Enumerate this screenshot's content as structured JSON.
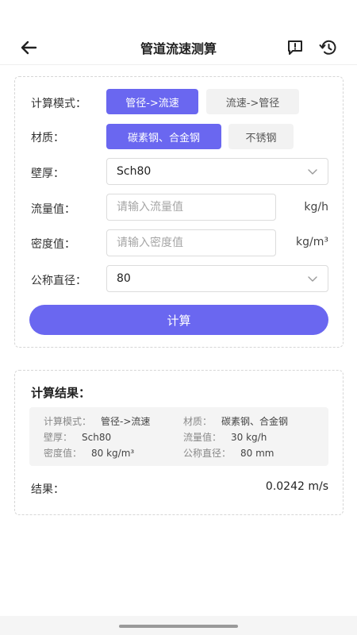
{
  "header": {
    "title": "管道流速测算",
    "back_icon": "arrow-left-icon",
    "feedback_icon": "feedback-icon",
    "history_icon": "history-icon"
  },
  "form": {
    "mode": {
      "label": "计算模式：",
      "options": [
        "管径->流速",
        "流速->管径"
      ],
      "selected": "管径->流速"
    },
    "material": {
      "label": "材质：",
      "options": [
        "碳素钢、合金钢",
        "不锈钢"
      ],
      "selected": "碳素钢、合金钢"
    },
    "wall": {
      "label": "壁厚：",
      "value": "Sch80"
    },
    "flow": {
      "label": "流量值：",
      "placeholder": "请输入流量值",
      "unit": "kg/h"
    },
    "density": {
      "label": "密度值：",
      "placeholder": "请输入密度值",
      "unit": "kg/m³"
    },
    "diameter": {
      "label": "公称直径：",
      "value": "80"
    },
    "calc_label": "计算"
  },
  "result": {
    "title": "计算结果：",
    "summary": {
      "mode": {
        "k": "计算模式：",
        "v": "管径->流速"
      },
      "material": {
        "k": "材质：",
        "v": "碳素钢、合金钢"
      },
      "wall": {
        "k": "壁厚：",
        "v": "Sch80"
      },
      "flow": {
        "k": "流量值：",
        "v": "30 kg/h"
      },
      "density": {
        "k": "密度值：",
        "v": "80 kg/m³"
      },
      "diameter": {
        "k": "公称直径：",
        "v": "80 mm"
      }
    },
    "label": "结果：",
    "value": "0.0242 m/s"
  },
  "colors": {
    "accent": "#6a67f0",
    "inactive": "#f2f2f2"
  }
}
